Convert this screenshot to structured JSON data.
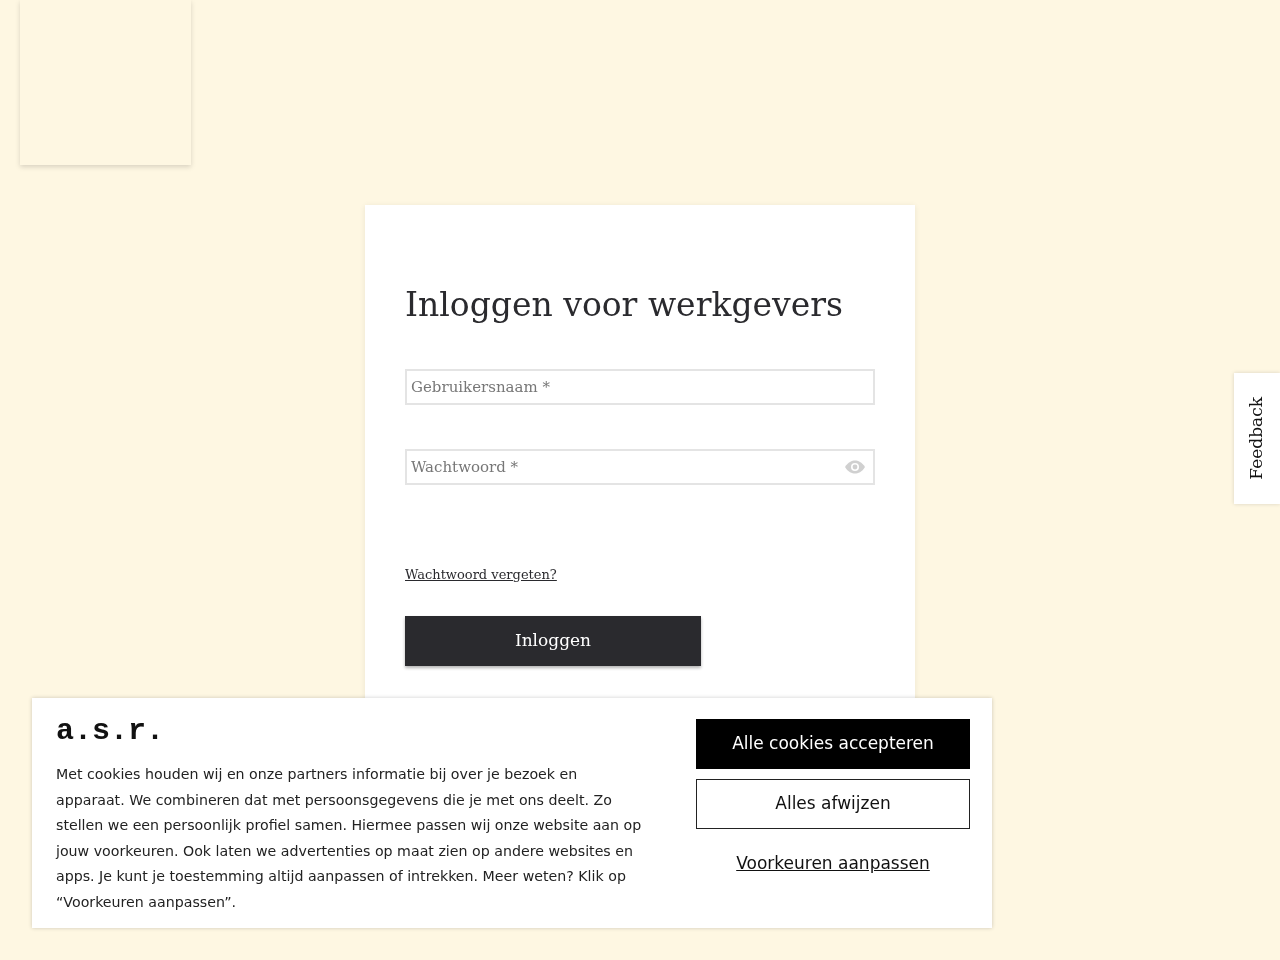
{
  "login": {
    "title": "Inloggen voor werkgevers",
    "fields": [
      {
        "placeholder": "Gebruikersnaam *",
        "kind": "text"
      },
      {
        "placeholder": "Wachtwoord *",
        "kind": "password"
      }
    ],
    "forgot_link": "Wachtwoord vergeten?",
    "submit": "Inloggen"
  },
  "feedback_tab": "Feedback",
  "cookie_banner": {
    "logo": "a.s.r.",
    "text": "Met cookies houden wij en onze partners informatie bij over je bezoek en apparaat. We combineren dat met persoonsgegevens die je met ons deelt. Zo stellen we een persoonlijk profiel samen. Hiermee passen wij onze website aan op jouw voorkeuren. Ook laten we advertenties op maat zien op andere websites en apps. Je kunt je toestemming altijd aanpassen of intrekken. Meer weten? Klik op “Voorkeuren aanpassen”.",
    "buttons": [
      {
        "label": "Alle cookies accepteren",
        "kind": "primary"
      },
      {
        "label": "Alles afwijzen",
        "kind": "outline"
      },
      {
        "label": "Voorkeuren aanpassen",
        "kind": "link"
      }
    ]
  }
}
